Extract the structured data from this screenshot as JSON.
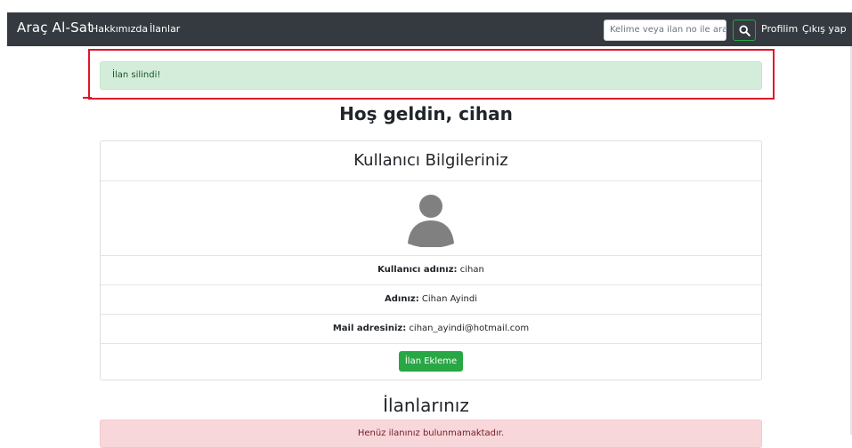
{
  "navbar": {
    "brand": "Araç Al-Sat",
    "links": [
      "Hakkımızda",
      "İlanlar"
    ],
    "search_placeholder": "Kelime veya ilan no ile ara",
    "right_links": [
      "Profilim",
      "Çıkış yap"
    ]
  },
  "alert": {
    "message": "İlan silindi!"
  },
  "welcome": "Hoş geldin, cihan",
  "user_card": {
    "title": "Kullanıcı Bilgileriniz",
    "username_label": "Kullanıcı adınız:",
    "username_value": "cihan",
    "name_label": "Adınız:",
    "name_value": "Cihan Ayindi",
    "email_label": "Mail adresiniz:",
    "email_value": "cihan_ayindi@hotmail.com",
    "add_button": "İlan Ekleme"
  },
  "listings": {
    "title": "İlanlarınız",
    "empty_message": "Henüz ilanınız bulunmamaktadır."
  },
  "colors": {
    "navbar": "#343a40",
    "success_bg": "#d4edda",
    "success_text": "#155724",
    "button": "#28a745",
    "danger_bg": "#f8d7da",
    "annotation": "#e3142a"
  }
}
